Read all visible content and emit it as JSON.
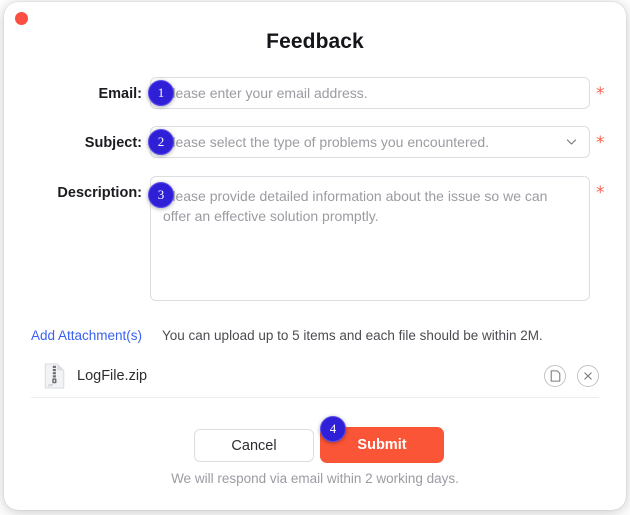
{
  "window": {
    "close_button": "close-dot",
    "title": "Feedback"
  },
  "form": {
    "email": {
      "label": "Email:",
      "placeholder": "Please enter your email address.",
      "required_marker": "*"
    },
    "subject": {
      "label": "Subject:",
      "placeholder": "Please select the type of problems you encountered.",
      "required_marker": "*",
      "dropdown_icon": "chevron-down-icon"
    },
    "description": {
      "label": "Description:",
      "placeholder": "Please provide detailed information about the issue so we can offer an effective solution promptly.",
      "required_marker": "*"
    }
  },
  "attachments": {
    "link_label": "Add Attachment(s)",
    "hint": "You can upload up to 5 items and each file should be within 2M.",
    "files": [
      {
        "name": "LogFile.zip",
        "icon": "zip-file-icon",
        "preview_icon": "document-icon",
        "remove_icon": "close-x-icon"
      }
    ]
  },
  "actions": {
    "cancel_label": "Cancel",
    "submit_label": "Submit"
  },
  "footer": {
    "note": "We will respond via email within 2 working days."
  },
  "annotations": [
    {
      "number": "1",
      "target": "email-input"
    },
    {
      "number": "2",
      "target": "subject-select"
    },
    {
      "number": "3",
      "target": "description-textarea"
    },
    {
      "number": "4",
      "target": "submit-button"
    }
  ],
  "colors": {
    "accent_submit": "#fa5536",
    "link": "#3b61f2",
    "required": "#f8604f",
    "badge": "#2f20d8",
    "close_dot": "#fb4f43"
  }
}
